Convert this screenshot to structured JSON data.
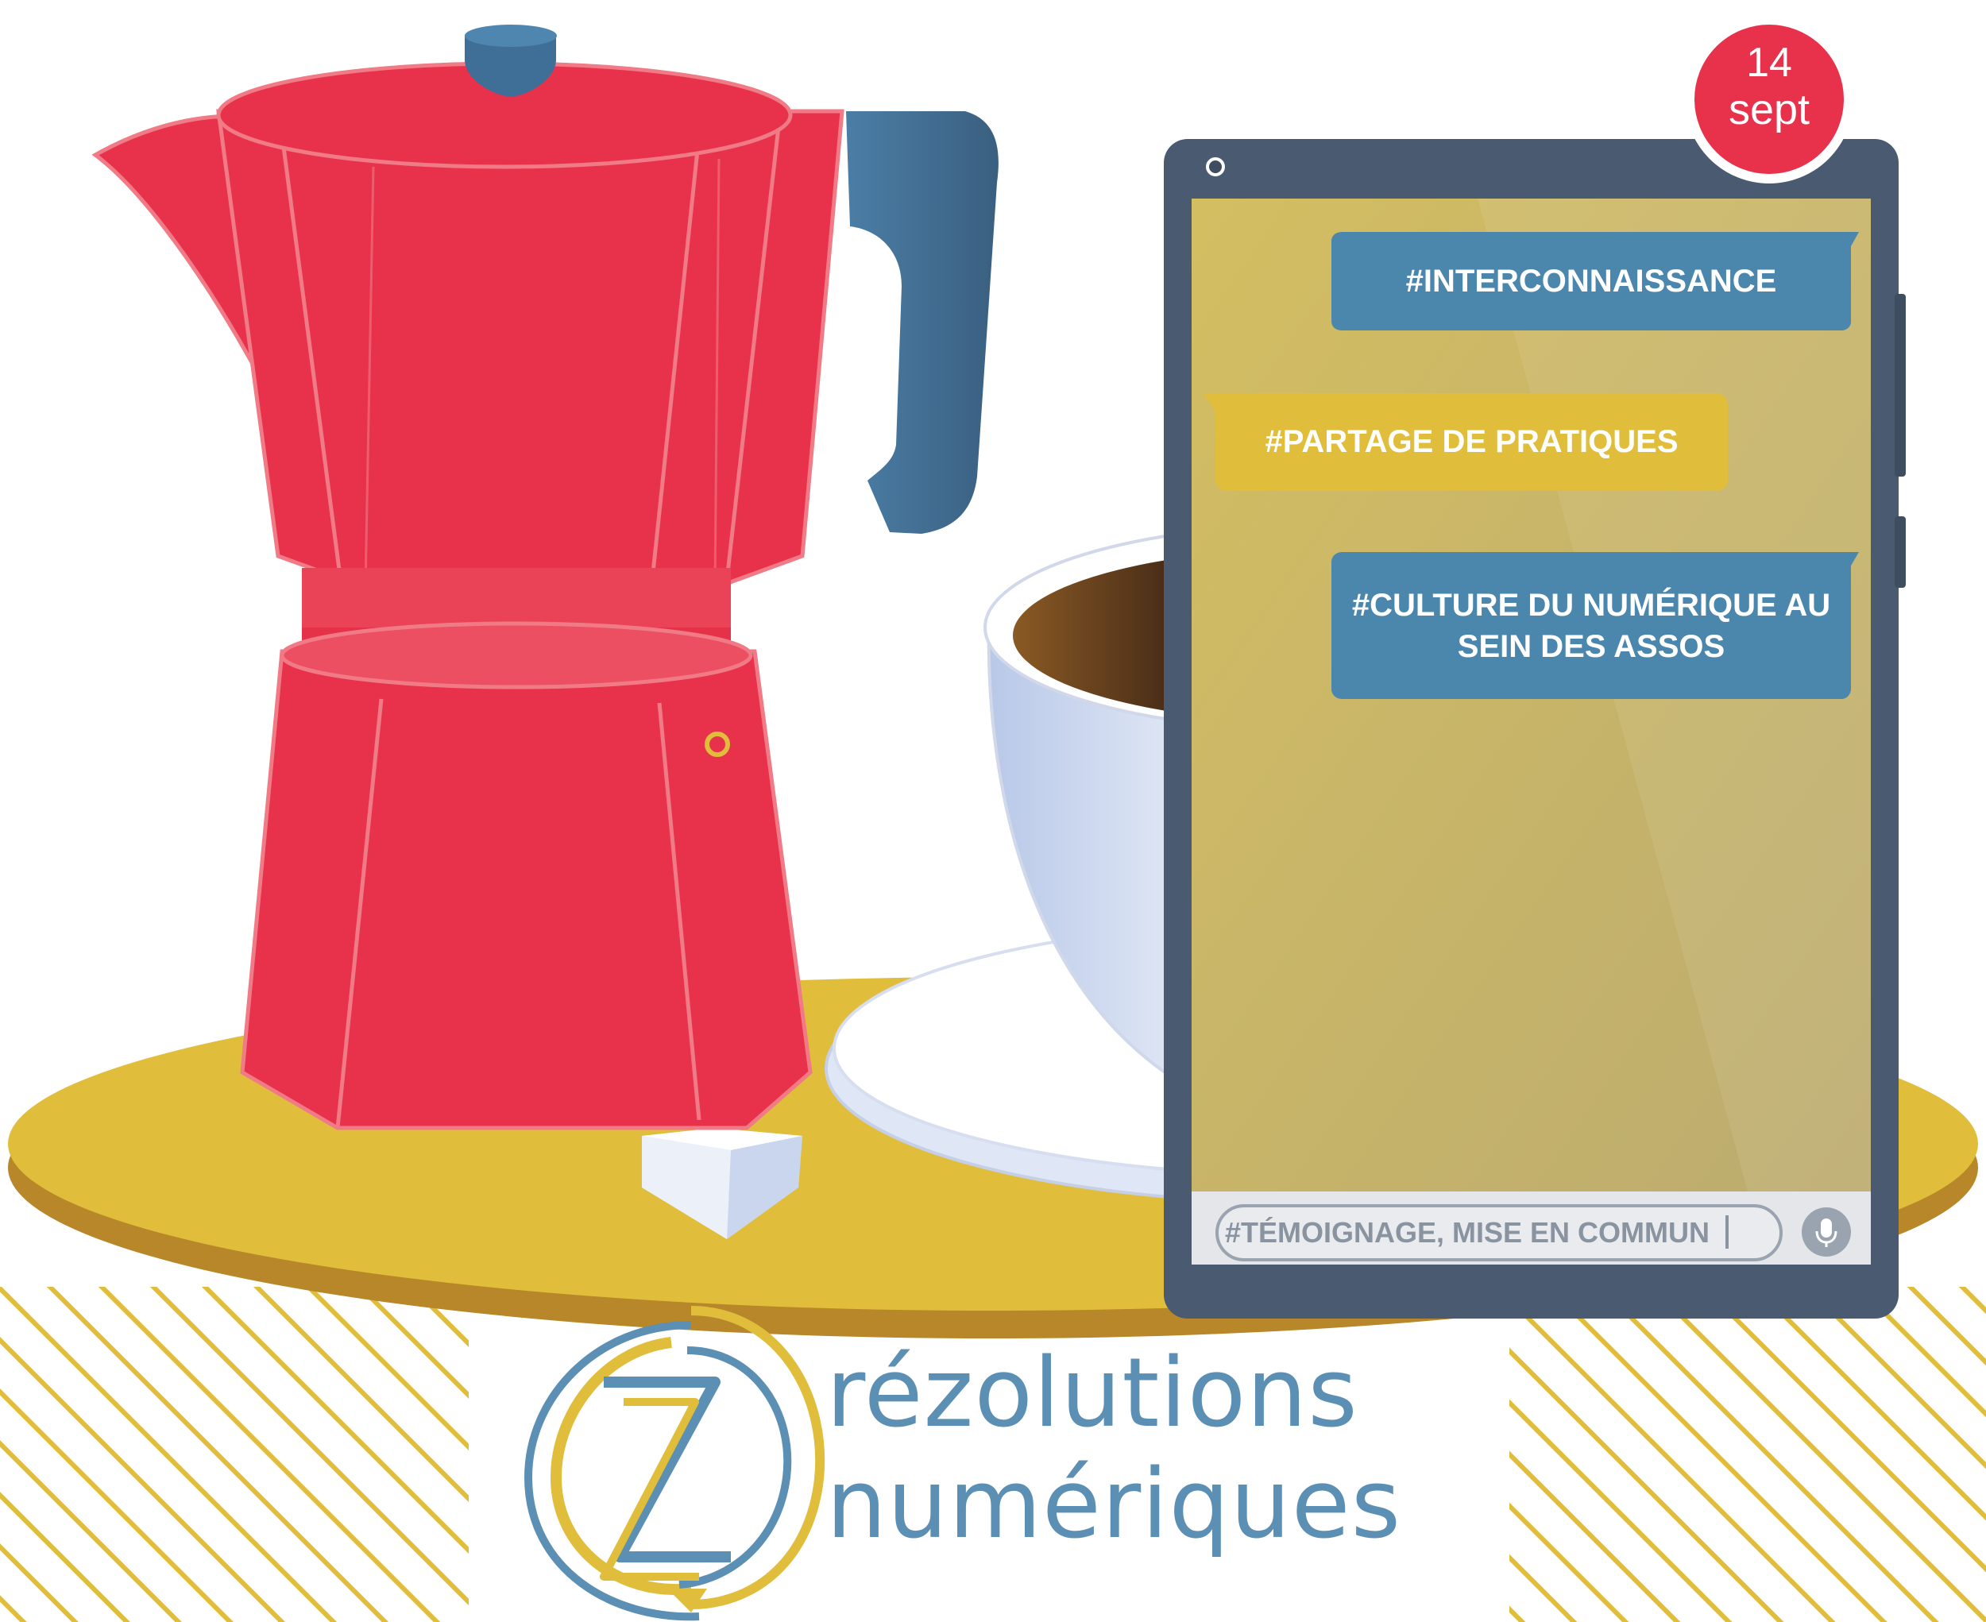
{
  "date_badge": {
    "day": "14",
    "month": "sept"
  },
  "messages": [
    {
      "text": "#INTERCONNAISSANCE"
    },
    {
      "text": "#PARTAGE DE PRATIQUES"
    },
    {
      "line1": "#CULTURE DU NUMÉRIQUE AU",
      "line2": "SEIN DES ASSOS"
    }
  ],
  "input_bar": {
    "value": "#TÉMOIGNAGE, MISE EN COMMUN"
  },
  "brand": {
    "line1": "rézolutions",
    "line2": "numériques"
  },
  "colors": {
    "red": "#e8324b",
    "blue": "#4b86ad",
    "yellow": "#e0be3b",
    "dark_slate": "#4a5a70",
    "brand_blue": "#5b8fb3"
  },
  "icons": [
    "microphone-icon",
    "camera-icon"
  ]
}
